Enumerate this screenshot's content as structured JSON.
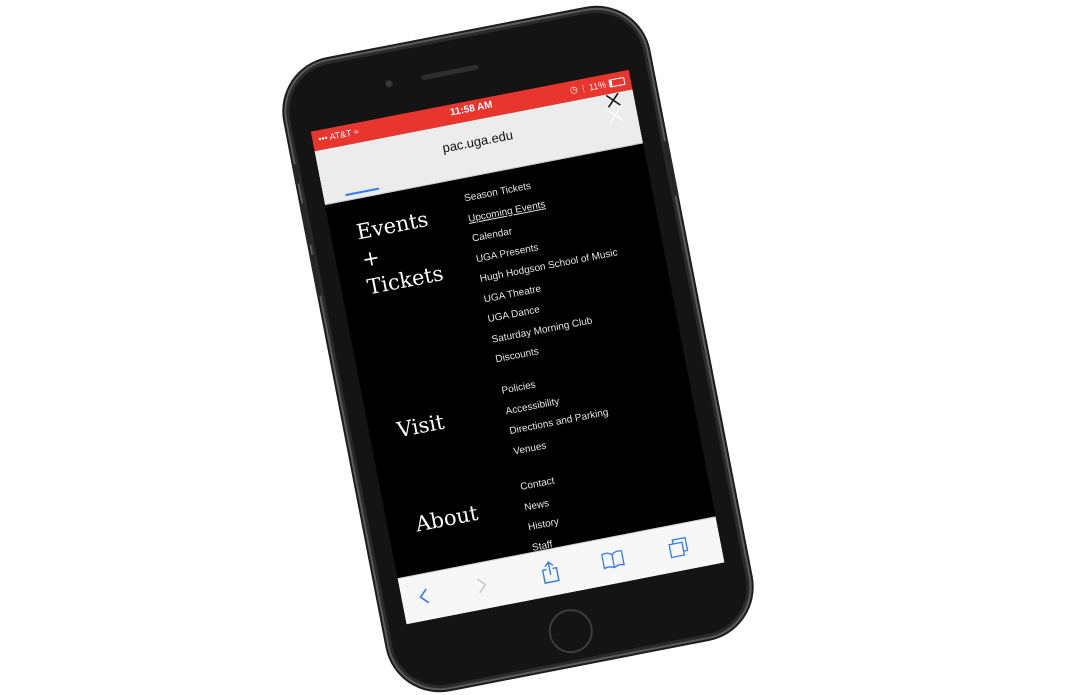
{
  "status": {
    "carrier": "AT&T",
    "time": "11:58 AM",
    "battery": "11%"
  },
  "browser": {
    "url": "pac.uga.edu"
  },
  "menu": {
    "sections": [
      {
        "title": "Events + Tickets",
        "links": [
          "Season Tickets",
          "Upcoming Events",
          "Calendar",
          "UGA Presents",
          "Hugh Hodgson School of Music",
          "UGA Theatre",
          "UGA Dance",
          "Saturday Morning Club",
          "Discounts"
        ]
      },
      {
        "title": "Visit",
        "links": [
          "Policies",
          "Accessibility",
          "Directions and Parking",
          "Venues"
        ]
      },
      {
        "title": "About",
        "links": [
          "Contact",
          "News",
          "History",
          "Staff"
        ]
      }
    ]
  },
  "icons": {
    "url_close": "close-icon",
    "menu_close": "close-icon",
    "back": "chevron-left-icon",
    "forward": "chevron-right-icon",
    "share": "share-icon",
    "bookmarks": "book-icon",
    "tabs": "tabs-icon"
  },
  "colors": {
    "status_bar": "#e8352d",
    "menu_bg": "#000000",
    "accent": "#2f7cf6"
  }
}
